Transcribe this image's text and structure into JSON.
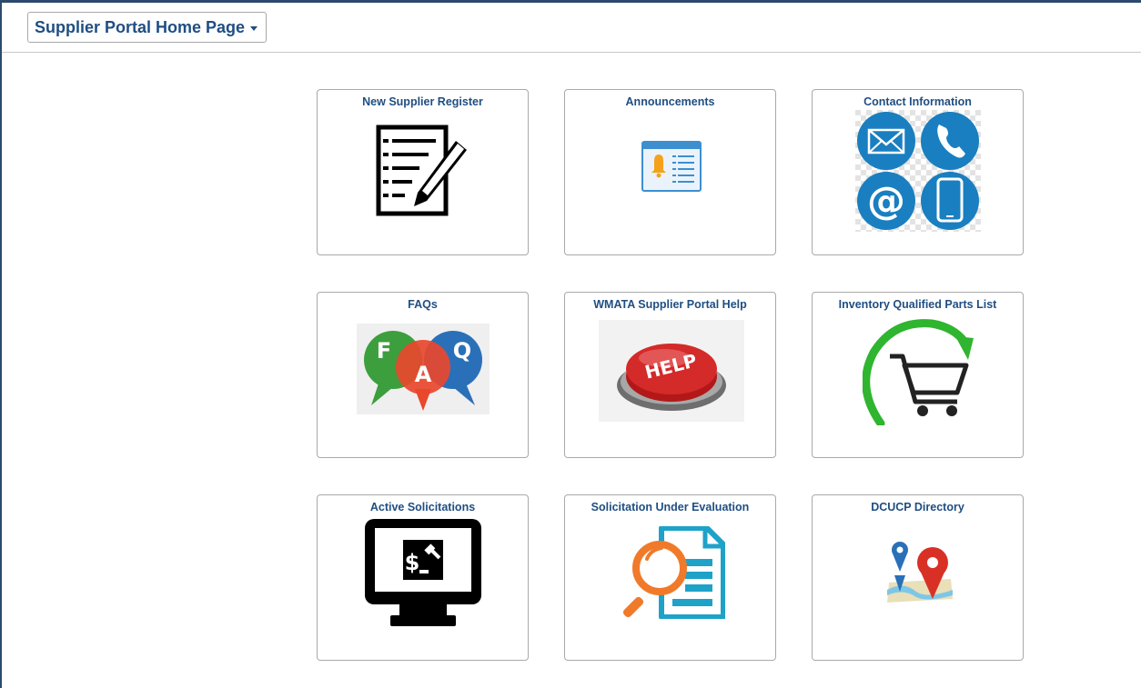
{
  "header": {
    "page_selector_label": "Supplier Portal Home Page"
  },
  "tiles": [
    {
      "title": "New Supplier Register",
      "icon": "registration-form-icon"
    },
    {
      "title": "Announcements",
      "icon": "announcement-bell-icon"
    },
    {
      "title": "Contact Information",
      "icon": "contact-methods-icon"
    },
    {
      "title": "FAQs",
      "icon": "faq-speech-bubbles-icon"
    },
    {
      "title": "WMATA Supplier Portal Help",
      "icon": "help-button-icon"
    },
    {
      "title": "Inventory Qualified Parts List",
      "icon": "shopping-cart-refresh-icon"
    },
    {
      "title": "Active Solicitations",
      "icon": "auction-monitor-icon"
    },
    {
      "title": "Solicitation Under Evaluation",
      "icon": "document-magnifier-icon"
    },
    {
      "title": "DCUCP Directory",
      "icon": "map-pins-icon"
    }
  ],
  "image_text": {
    "faq_letters": [
      "F",
      "A",
      "Q"
    ],
    "help_button_text": "HELP",
    "contact_at_symbol": "@",
    "auction_symbol": "$"
  },
  "colors": {
    "title_blue": "#1f4e82",
    "frame_blue": "#2b4a6e",
    "tile_border": "#a9a9a9",
    "contact_blue": "#1a7fc0",
    "help_red": "#d42a2a",
    "cart_green": "#2fb52f"
  }
}
